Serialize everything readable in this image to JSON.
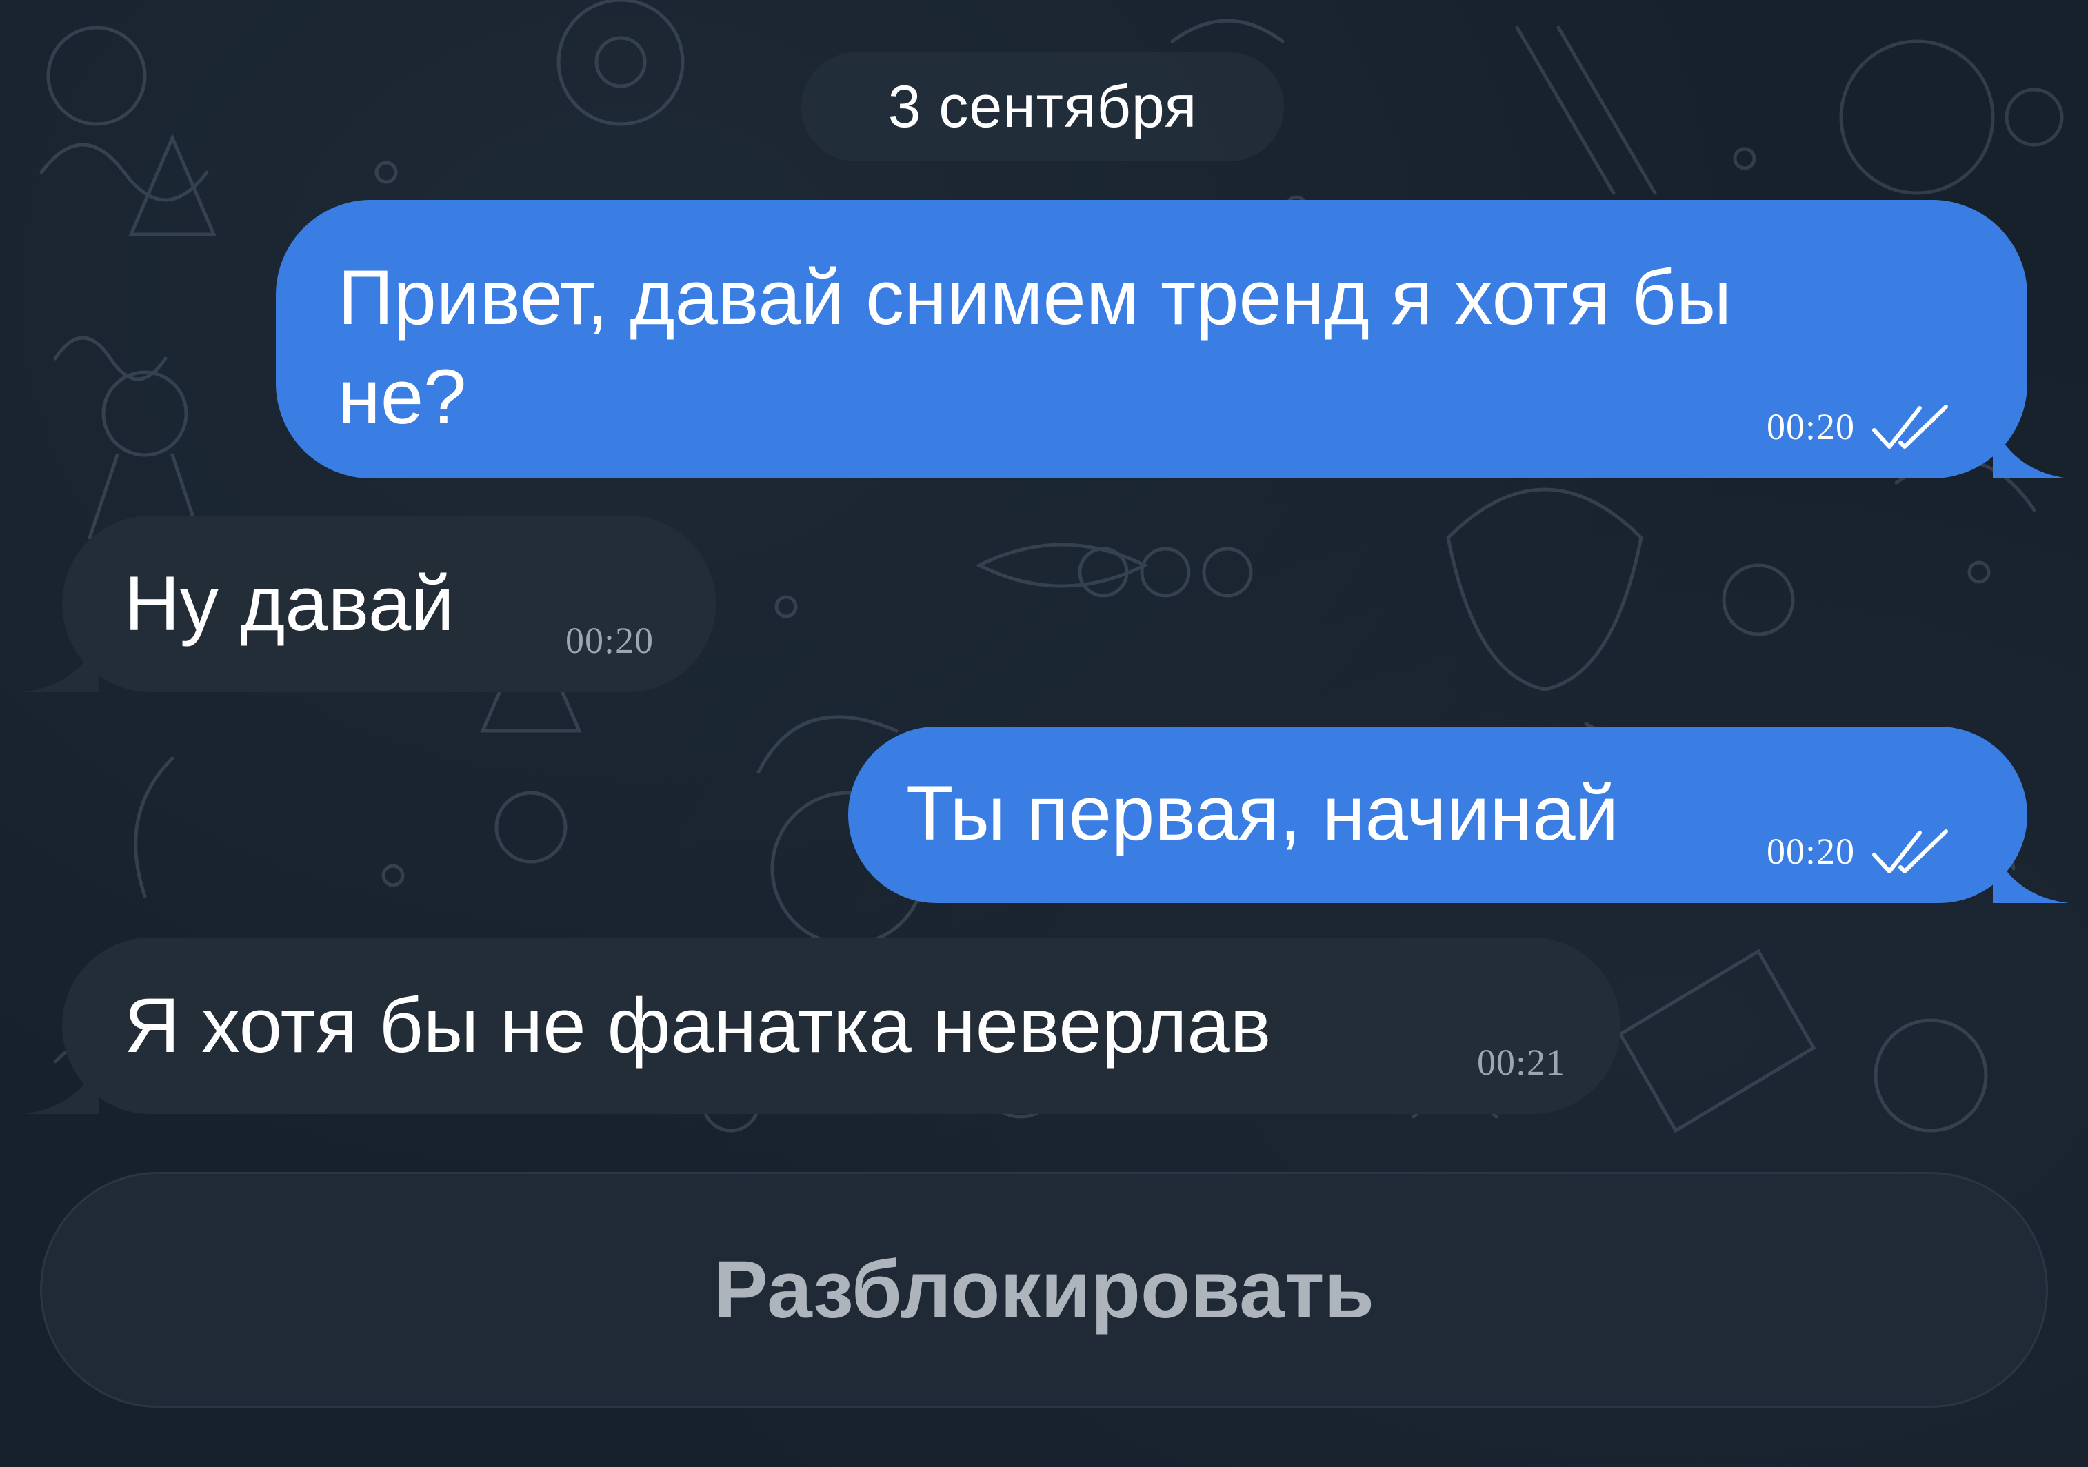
{
  "chat": {
    "date_separator": "3 сентября",
    "messages": [
      {
        "direction": "outgoing",
        "text": "Привет, давай снимем тренд я хотя бы\nне?",
        "time": "00:20",
        "status_icon": "double-check-icon"
      },
      {
        "direction": "incoming",
        "text": "Ну давай",
        "time": "00:20"
      },
      {
        "direction": "outgoing",
        "text": "Ты первая, начинай",
        "time": "00:20",
        "status_icon": "double-check-icon"
      },
      {
        "direction": "incoming",
        "text": "Я хотя бы не фанатка неверлав",
        "time": "00:21"
      }
    ]
  },
  "footer": {
    "unblock_label": "Разблокировать"
  },
  "colors": {
    "background": "#17212c",
    "outgoing_bubble": "#3a7ee3",
    "incoming_bubble": "#222d38",
    "date_pill": "#222e3a",
    "unblock_button": "#1f2a36",
    "unblock_text": "#aeb4bb"
  }
}
